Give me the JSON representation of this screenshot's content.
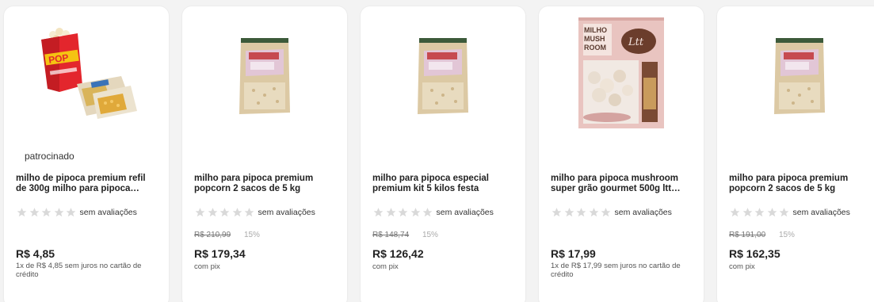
{
  "cards": [
    {
      "image_icon": "popcorn-box-and-bags-image",
      "sponsored": "patrocinado",
      "title_line1": "milho de pipoca premium refil",
      "title_line2": "de 300g milho para pipoca…",
      "rating_text": "sem avaliações",
      "price": "R$ 4,85",
      "subtext": "1x de R$ 4,85 sem juros no cartão de crédito"
    },
    {
      "image_icon": "popcorn-sack-image",
      "title_line1": "milho para pipoca premium",
      "title_line2": "popcorn 2 sacos de 5 kg",
      "rating_text": "sem avaliações",
      "old_price": "R$ 210,99",
      "discount": "15%",
      "price": "R$ 179,34",
      "subtext": "com pix"
    },
    {
      "image_icon": "popcorn-sack-image",
      "title_line1": "milho para pipoca especial",
      "title_line2": "premium kit 5 kilos festa",
      "rating_text": "sem avaliações",
      "old_price": "R$ 148,74",
      "discount": "15%",
      "price": "R$ 126,42",
      "subtext": "com pix"
    },
    {
      "image_icon": "mushroom-popcorn-package-image",
      "image_label_1": "MILHO",
      "image_label_2": "MUSH",
      "image_label_3": "ROOM",
      "image_brand": "Ltt",
      "title_line1": "milho para pipoca mushroom",
      "title_line2": "super grão gourmet 500g ltt…",
      "rating_text": "sem avaliações",
      "price": "R$ 17,99",
      "subtext": "1x de R$ 17,99 sem juros no cartão de crédito"
    },
    {
      "image_icon": "popcorn-sack-image",
      "title_line1": "milho para pipoca premium",
      "title_line2": "popcorn 2 sacos de 5 kg",
      "rating_text": "sem avaliações",
      "old_price": "R$ 191,00",
      "discount": "15%",
      "price": "R$ 162,35",
      "subtext": "com pix"
    }
  ],
  "colors": {
    "star_empty": "#d9d9d9",
    "sack_body": "#dcc9a4",
    "sack_label": "#c64a4f",
    "box_red": "#e3262d",
    "box_yellow": "#f5c312"
  }
}
